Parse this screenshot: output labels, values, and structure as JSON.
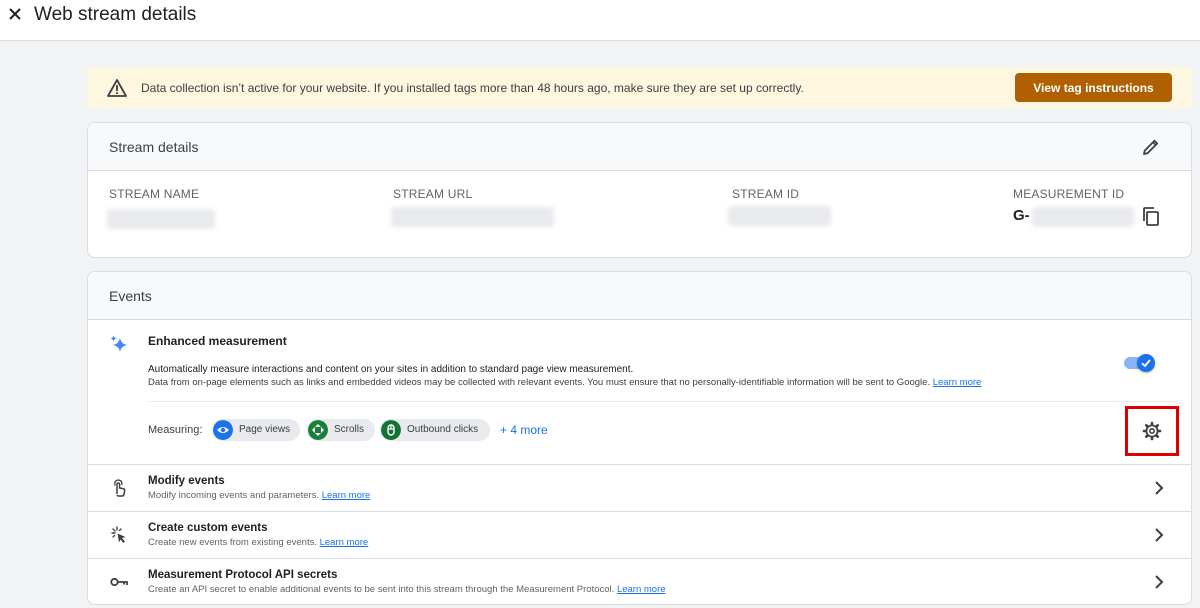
{
  "header": {
    "title": "Web stream details"
  },
  "banner": {
    "message": "Data collection isn’t active for your website. If you installed tags more than 48 hours ago, make sure they are set up correctly.",
    "button_label": "View tag instructions"
  },
  "stream_details": {
    "title": "Stream details",
    "columns": {
      "name_label": "STREAM NAME",
      "url_label": "STREAM URL",
      "id_label": "STREAM ID",
      "measurement_label": "MEASUREMENT ID"
    },
    "measurement_id_prefix": "G-"
  },
  "events": {
    "title": "Events",
    "enhanced": {
      "title": "Enhanced measurement",
      "description": "Automatically measure interactions and content on your sites in addition to standard page view measurement.",
      "note": "Data from on-page elements such as links and embedded videos may be collected with relevant events. You must ensure that no personally-identifiable information will be sent to Google.",
      "learn_more": "Learn more",
      "enabled": true,
      "measuring_label": "Measuring:",
      "chips": [
        "Page views",
        "Scrolls",
        "Outbound clicks"
      ],
      "more": "+ 4 more"
    },
    "rows": [
      {
        "title": "Modify events",
        "description": "Modify incoming events and parameters.",
        "link": "Learn more"
      },
      {
        "title": "Create custom events",
        "description": "Create new events from existing events.",
        "link": "Learn more"
      },
      {
        "title": "Measurement Protocol API secrets",
        "description": "Create an API secret to enable additional events to be sent into this stream through the Measurement Protocol.",
        "link": "Learn more"
      }
    ]
  },
  "colors": {
    "accent": "#1a73e8",
    "banner_bg": "#fef7e0",
    "banner_button": "#b06000",
    "highlight": "#e00000",
    "chip_page_views": "#1a73e8",
    "chip_scrolls": "#188038",
    "chip_outbound": "#137333"
  },
  "icons": {
    "close": "close-icon",
    "warning": "warning-icon",
    "edit": "pencil-icon",
    "copy": "copy-icon",
    "enhanced": "sparkle-icon",
    "settings": "gear-icon",
    "modify_events": "touch-icon",
    "custom_events": "cursor-click-icon",
    "api_secrets": "key-icon"
  }
}
